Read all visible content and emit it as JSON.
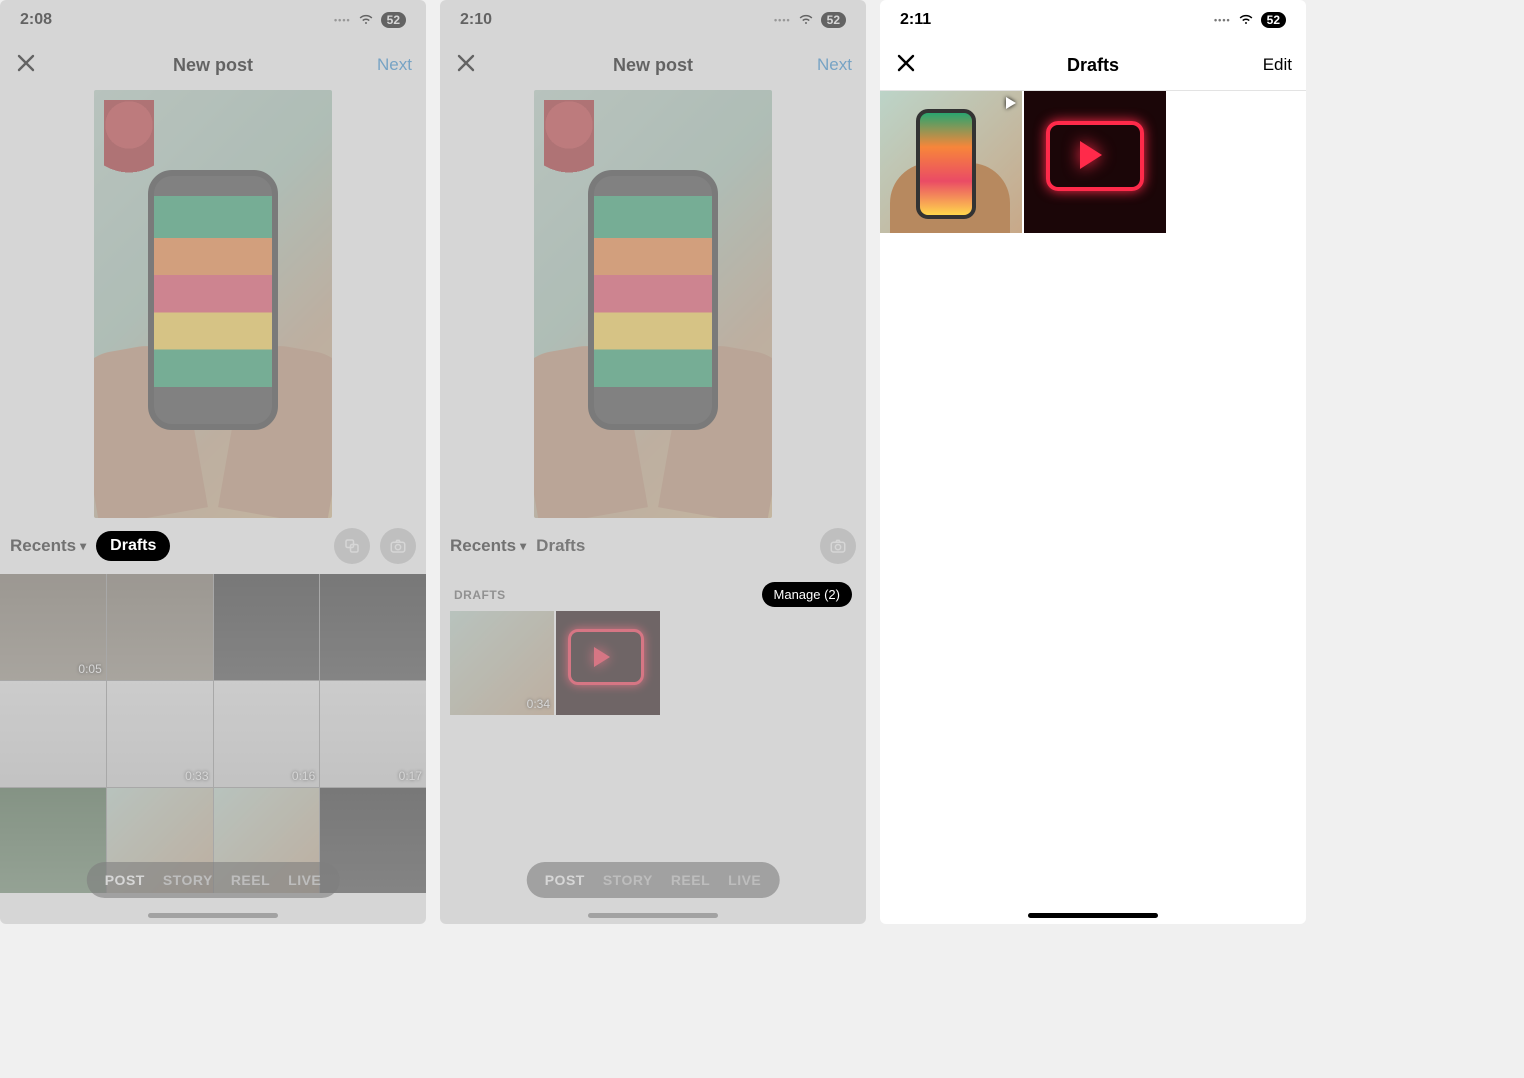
{
  "screen1": {
    "status": {
      "time": "2:08",
      "battery": "52"
    },
    "nav": {
      "title": "New post",
      "next": "Next"
    },
    "sources": {
      "recents": "Recents",
      "drafts_pill": "Drafts"
    },
    "grid_durations": [
      "0:05",
      "",
      "",
      "",
      "",
      "0:33",
      "0:16",
      "0:17",
      "",
      "",
      "",
      ""
    ],
    "modes": [
      "POST",
      "STORY",
      "REEL",
      "LIVE"
    ]
  },
  "screen2": {
    "status": {
      "time": "2:10",
      "battery": "52"
    },
    "nav": {
      "title": "New post",
      "next": "Next"
    },
    "sources": {
      "recents": "Recents",
      "drafts": "Drafts"
    },
    "drafts_label": "DRAFTS",
    "manage": "Manage (2)",
    "draft_durations": [
      "0:34",
      ""
    ],
    "modes": [
      "POST",
      "STORY",
      "REEL",
      "LIVE"
    ]
  },
  "screen3": {
    "status": {
      "time": "2:11",
      "battery": "52"
    },
    "nav": {
      "title": "Drafts",
      "edit": "Edit"
    }
  }
}
